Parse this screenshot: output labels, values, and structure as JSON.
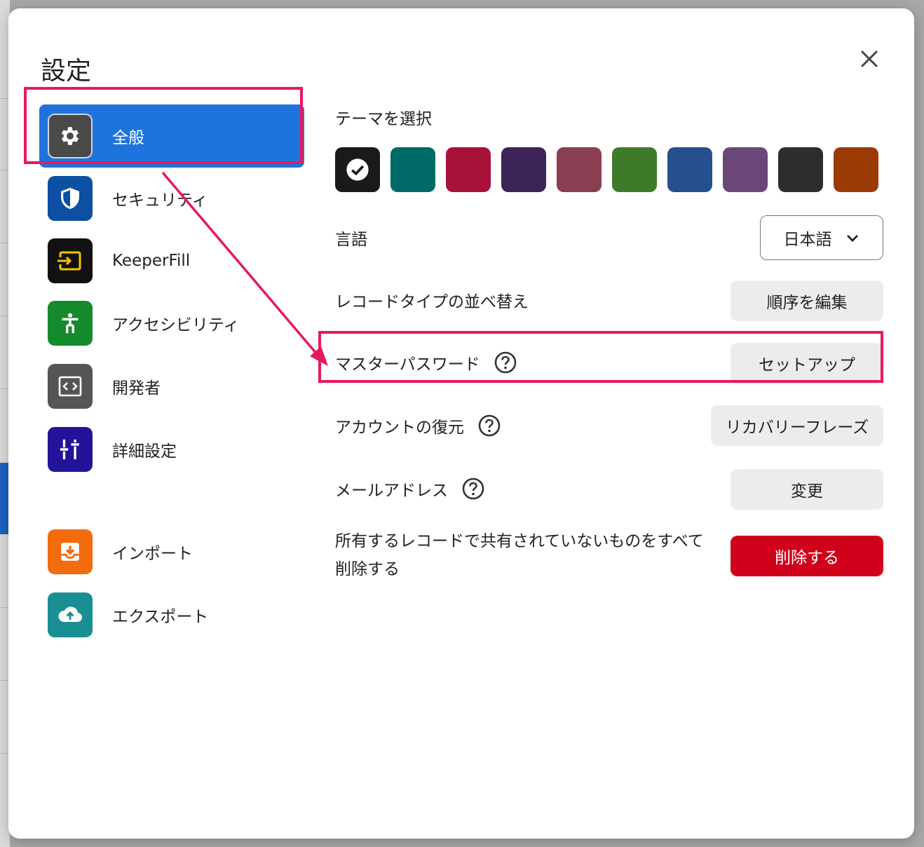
{
  "modal": {
    "title": "設定",
    "close_icon": "close-icon"
  },
  "sidebar": {
    "items": [
      {
        "label": "全般",
        "icon": "gear-icon",
        "color": "#4a4a4a",
        "active": true
      },
      {
        "label": "セキュリティ",
        "icon": "shield-icon",
        "color": "#0d4fa3"
      },
      {
        "label": "KeeperFill",
        "icon": "keeperfill-icon",
        "color": "#111111"
      },
      {
        "label": "アクセシビリティ",
        "icon": "accessibility-icon",
        "color": "#158a2c"
      },
      {
        "label": "開発者",
        "icon": "code-icon",
        "color": "#555555"
      },
      {
        "label": "詳細設定",
        "icon": "sliders-icon",
        "color": "#22139a"
      },
      {
        "label": "インポート",
        "icon": "import-icon",
        "color": "#f26c0d"
      },
      {
        "label": "エクスポート",
        "icon": "cloud-upload-icon",
        "color": "#1a8f93"
      }
    ]
  },
  "theme": {
    "label": "テーマを選択",
    "swatches": [
      "#1a1a1a",
      "#006b66",
      "#a8123a",
      "#3d2457",
      "#8a3e52",
      "#3f7a2a",
      "#264f8e",
      "#6a4778",
      "#2d2d2d",
      "#9a3a05"
    ],
    "selected_index": 0
  },
  "language": {
    "label": "言語",
    "value": "日本語"
  },
  "record_types": {
    "label": "レコードタイプの並べ替え",
    "button": "順序を編集"
  },
  "master_password": {
    "label": "マスターパスワード",
    "button": "セットアップ"
  },
  "account_recovery": {
    "label": "アカウントの復元",
    "button": "リカバリーフレーズ"
  },
  "email": {
    "label": "メールアドレス",
    "button": "変更"
  },
  "delete_unshared": {
    "label": "所有するレコードで共有されていないものをすべて削除する",
    "button": "削除する"
  },
  "colors": {
    "accent": "#1e74dc",
    "danger": "#d0021b",
    "annotation": "#e8185f"
  }
}
